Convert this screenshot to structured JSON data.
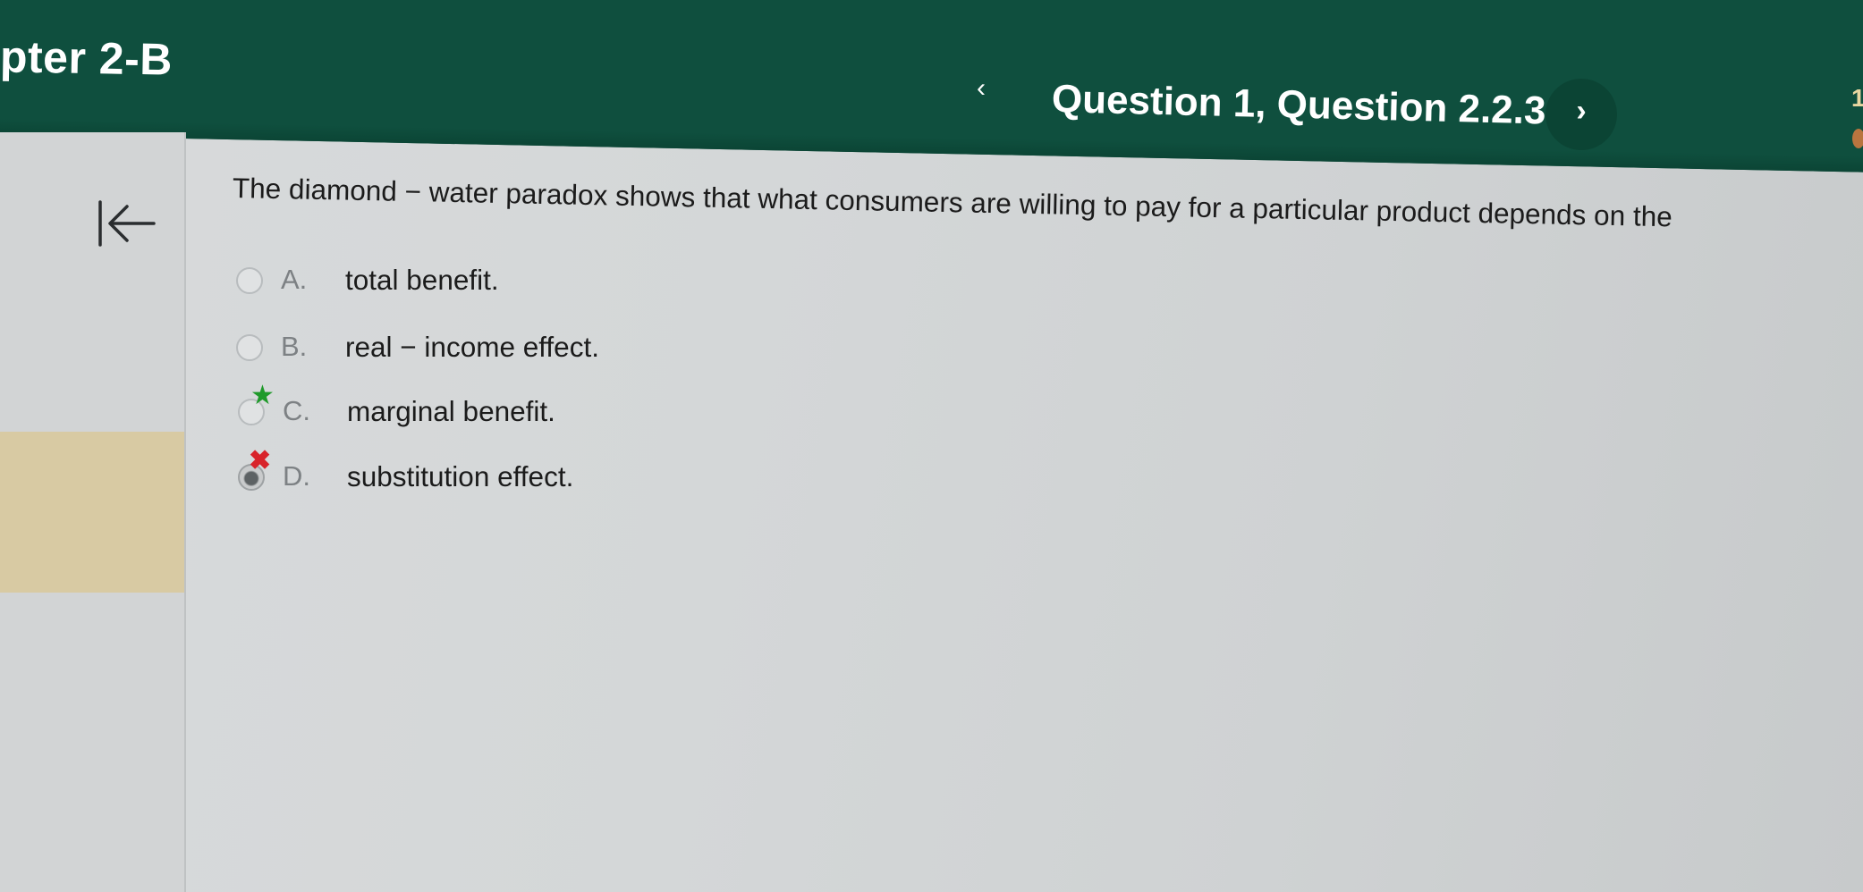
{
  "header": {
    "chapter_title": "pter 2-B",
    "question_title": "Question 1, Question 2.2.3",
    "prev_icon": "‹",
    "next_icon": "›",
    "edge_glyph": "1"
  },
  "question": {
    "text": "The diamond − water paradox shows that what consumers are willing to pay for a particular product depends on the",
    "options": [
      {
        "letter": "A.",
        "text": "total benefit.",
        "state": "unselected"
      },
      {
        "letter": "B.",
        "text": "real − income effect.",
        "state": "unselected"
      },
      {
        "letter": "C.",
        "text": "marginal benefit.",
        "state": "correct-answer",
        "mark_icon": "★"
      },
      {
        "letter": "D.",
        "text": "substitution effect.",
        "state": "selected-incorrect",
        "mark_icon": "✖"
      }
    ]
  },
  "colors": {
    "header_green": "#0f4f3e",
    "correct_green": "#1f9a2a",
    "incorrect_red": "#d8232a",
    "sidebar_highlight": "#d8caa3"
  }
}
